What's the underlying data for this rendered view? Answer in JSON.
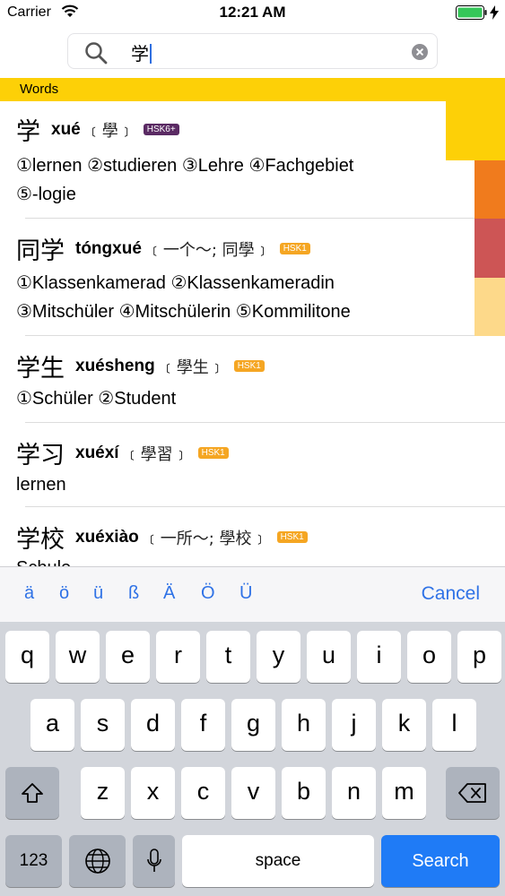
{
  "status": {
    "carrier": "Carrier",
    "time": "12:21 AM"
  },
  "search": {
    "value": "学"
  },
  "section": {
    "title": "Words"
  },
  "entries": [
    {
      "hanzi": "学",
      "pinyin": "xué",
      "variant": "﹝學﹞",
      "badge": "HSK6+",
      "badge_color": "#5a2a63",
      "defs": [
        "①lernen ②studieren ③Lehre ④Fachgebiet",
        "⑤-logie"
      ]
    },
    {
      "hanzi": "同学",
      "pinyin": "tóngxué",
      "variant": "﹝一个～; 同學﹞",
      "badge": "HSK1",
      "badge_color": "#f5a623",
      "defs": [
        "①Klassenkamerad ②Klassenkameradin",
        "③Mitschüler ④Mitschülerin ⑤Kommilitone"
      ]
    },
    {
      "hanzi": "学生",
      "pinyin": "xuésheng",
      "variant": "﹝學生﹞",
      "badge": "HSK1",
      "badge_color": "#f5a623",
      "defs": [
        "①Schüler ②Student"
      ]
    },
    {
      "hanzi": "学习",
      "pinyin": "xuéxí",
      "variant": "﹝學習﹞",
      "badge": "HSK1",
      "badge_color": "#f5a623",
      "defs": [
        "lernen"
      ]
    },
    {
      "hanzi": "学校",
      "pinyin": "xuéxiào",
      "variant": "﹝一所～; 學校﹞",
      "badge": "HSK1",
      "badge_color": "#f5a623",
      "defs": [
        "Schule"
      ]
    }
  ],
  "side_bar_colors": [
    "#fdd007",
    "#f07b1d",
    "#cd5555",
    "#fdd98a"
  ],
  "accessory": {
    "keys": [
      "ä",
      "ö",
      "ü",
      "ß",
      "Ä",
      "Ö",
      "Ü"
    ],
    "cancel": "Cancel"
  },
  "keyboard": {
    "row1": [
      "q",
      "w",
      "e",
      "r",
      "t",
      "y",
      "u",
      "i",
      "o",
      "p"
    ],
    "row2": [
      "a",
      "s",
      "d",
      "f",
      "g",
      "h",
      "j",
      "k",
      "l"
    ],
    "row3": [
      "z",
      "x",
      "c",
      "v",
      "b",
      "n",
      "m"
    ],
    "numbers": "123",
    "space": "space",
    "search": "Search"
  },
  "icons": {
    "wifi": "wifi-icon",
    "battery": "battery-icon",
    "search": "search-icon",
    "clear": "clear-icon",
    "shift": "shift-icon",
    "delete": "delete-icon",
    "globe": "globe-icon",
    "mic": "microphone-icon"
  },
  "accent_color": "#2f72e6"
}
